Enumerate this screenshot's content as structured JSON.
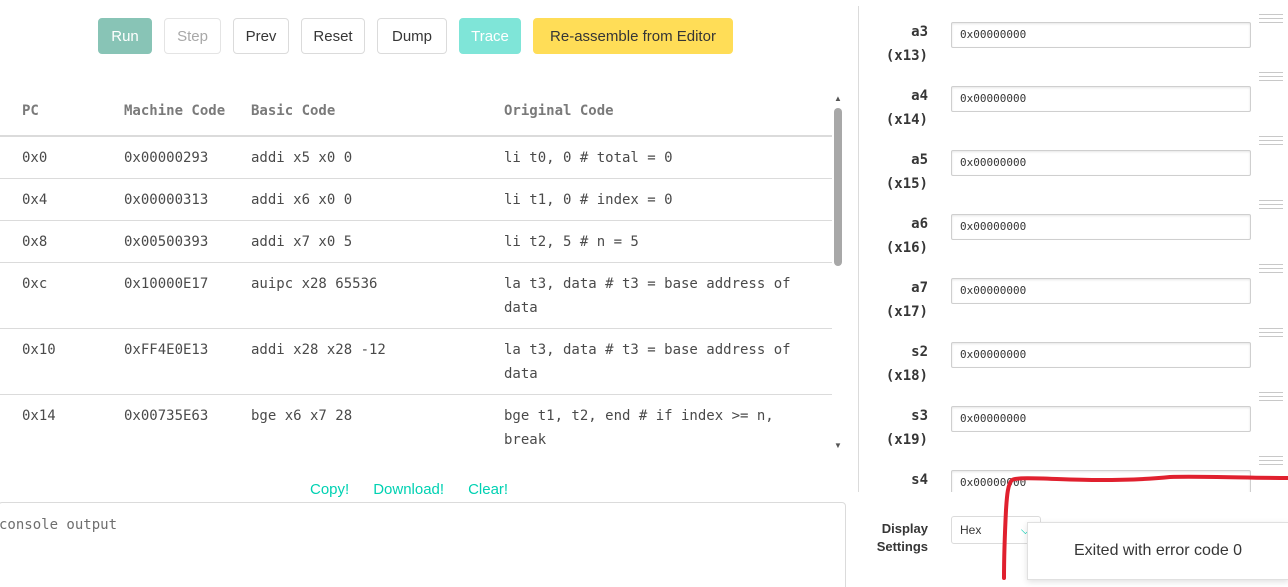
{
  "toolbar": {
    "run": "Run",
    "step": "Step",
    "prev": "Prev",
    "reset": "Reset",
    "dump": "Dump",
    "trace": "Trace",
    "reassemble": "Re-assemble from Editor"
  },
  "table": {
    "headers": [
      "PC",
      "Machine Code",
      "Basic Code",
      "Original Code"
    ],
    "rows": [
      {
        "pc": "0x0",
        "machine": "0x00000293",
        "basic": "addi x5 x0 0",
        "original": "li t0, 0 # total = 0"
      },
      {
        "pc": "0x4",
        "machine": "0x00000313",
        "basic": "addi x6 x0 0",
        "original": "li t1, 0 # index = 0"
      },
      {
        "pc": "0x8",
        "machine": "0x00500393",
        "basic": "addi x7 x0 5",
        "original": "li t2, 5 # n = 5"
      },
      {
        "pc": "0xc",
        "machine": "0x10000E17",
        "basic": "auipc x28 65536",
        "original": "la t3, data # t3 = base address of data"
      },
      {
        "pc": "0x10",
        "machine": "0xFF4E0E13",
        "basic": "addi x28 x28 -12",
        "original": "la t3, data # t3 = base address of data"
      },
      {
        "pc": "0x14",
        "machine": "0x00735E63",
        "basic": "bge x6 x7 28",
        "original": "bge t1, t2, end # if index >= n, break"
      }
    ]
  },
  "links": {
    "copy": "Copy!",
    "download": "Download!",
    "clear": "Clear!"
  },
  "console": {
    "placeholder": "console output"
  },
  "registers": [
    {
      "name": "a3",
      "num": "(x13)",
      "value": "0x00000000"
    },
    {
      "name": "a4",
      "num": "(x14)",
      "value": "0x00000000"
    },
    {
      "name": "a5",
      "num": "(x15)",
      "value": "0x00000000"
    },
    {
      "name": "a6",
      "num": "(x16)",
      "value": "0x00000000"
    },
    {
      "name": "a7",
      "num": "(x17)",
      "value": "0x00000000"
    },
    {
      "name": "s2",
      "num": "(x18)",
      "value": "0x00000000"
    },
    {
      "name": "s3",
      "num": "(x19)",
      "value": "0x00000000"
    },
    {
      "name": "s4",
      "num": "",
      "value": "0x00000000"
    }
  ],
  "display": {
    "label": "Display Settings",
    "selected": "Hex"
  },
  "toast": {
    "message": "Exited with error code 0"
  },
  "colors": {
    "run": "#88c4b6",
    "trace": "#7fe5d8",
    "reassemble": "#ffdd57",
    "link": "#00d1b2",
    "annotation": "#e0202e"
  },
  "icons": {
    "select_chevron": "chevron-down-icon",
    "scroll_up": "scroll-up-arrow-icon",
    "scroll_down": "scroll-down-arrow-icon",
    "drag_handle": "drag-handle-icon"
  }
}
